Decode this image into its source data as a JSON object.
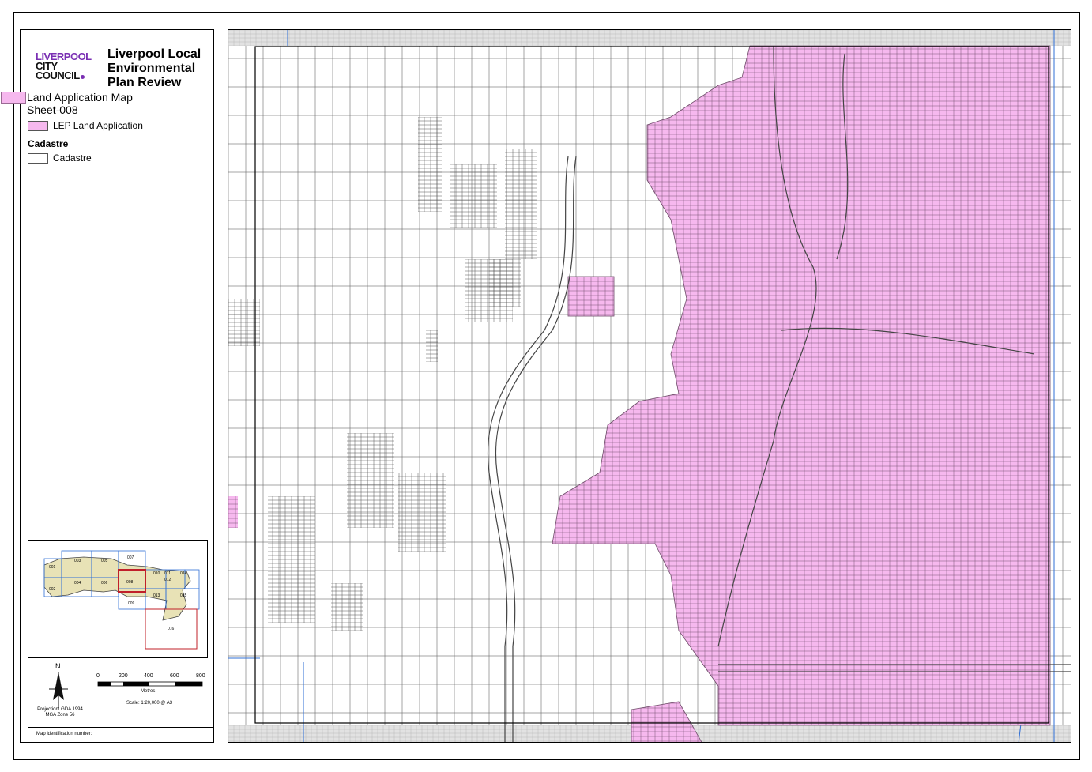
{
  "council": {
    "line1": "LIVERPOOL",
    "line2": "CITY",
    "line3": "COUNCIL"
  },
  "title": "Liverpool Local Environmental Plan Review",
  "map_name": "Land Application Map",
  "sheet_id": "Sheet-008",
  "legend": {
    "lep_label": "LEP Land Application",
    "cadastre_heading": "Cadastre",
    "cadastre_label": "Cadastre",
    "colors": {
      "lep": "#f6b8ee",
      "cadastre": "#ffffff",
      "outside": "#e2e2e2",
      "grid": "#2f6fd6",
      "key_red": "#c0202a",
      "key_fill": "#e8e2b6"
    }
  },
  "inset": {
    "sheets": [
      "001",
      "002",
      "003",
      "004",
      "005",
      "006",
      "007",
      "008",
      "009",
      "010",
      "011",
      "012",
      "013",
      "014",
      "015",
      "016"
    ],
    "highlighted": "008"
  },
  "north_label": "N",
  "scale": {
    "ticks": [
      "0",
      "200",
      "400",
      "600",
      "800"
    ],
    "unit": "Metres",
    "text": "Scale: 1:20,000 @ A3"
  },
  "projection": [
    "Projection: GDA 1994",
    "MGA Zone 56"
  ],
  "map_identification": "Map identification number:"
}
